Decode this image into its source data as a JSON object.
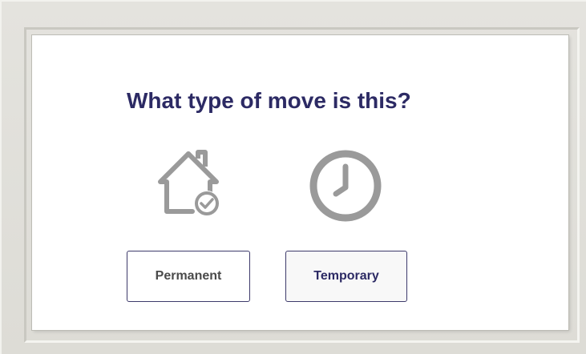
{
  "dialog": {
    "title": "What type of move is this?",
    "options": [
      {
        "label": "Permanent",
        "icon": "house-check-icon"
      },
      {
        "label": "Temporary",
        "icon": "clock-icon"
      }
    ]
  },
  "colors": {
    "title": "#2c2a64",
    "icon_gray": "#9a9a9a",
    "button_border": "#3d3a6b",
    "frame": "#dcdbd5"
  }
}
